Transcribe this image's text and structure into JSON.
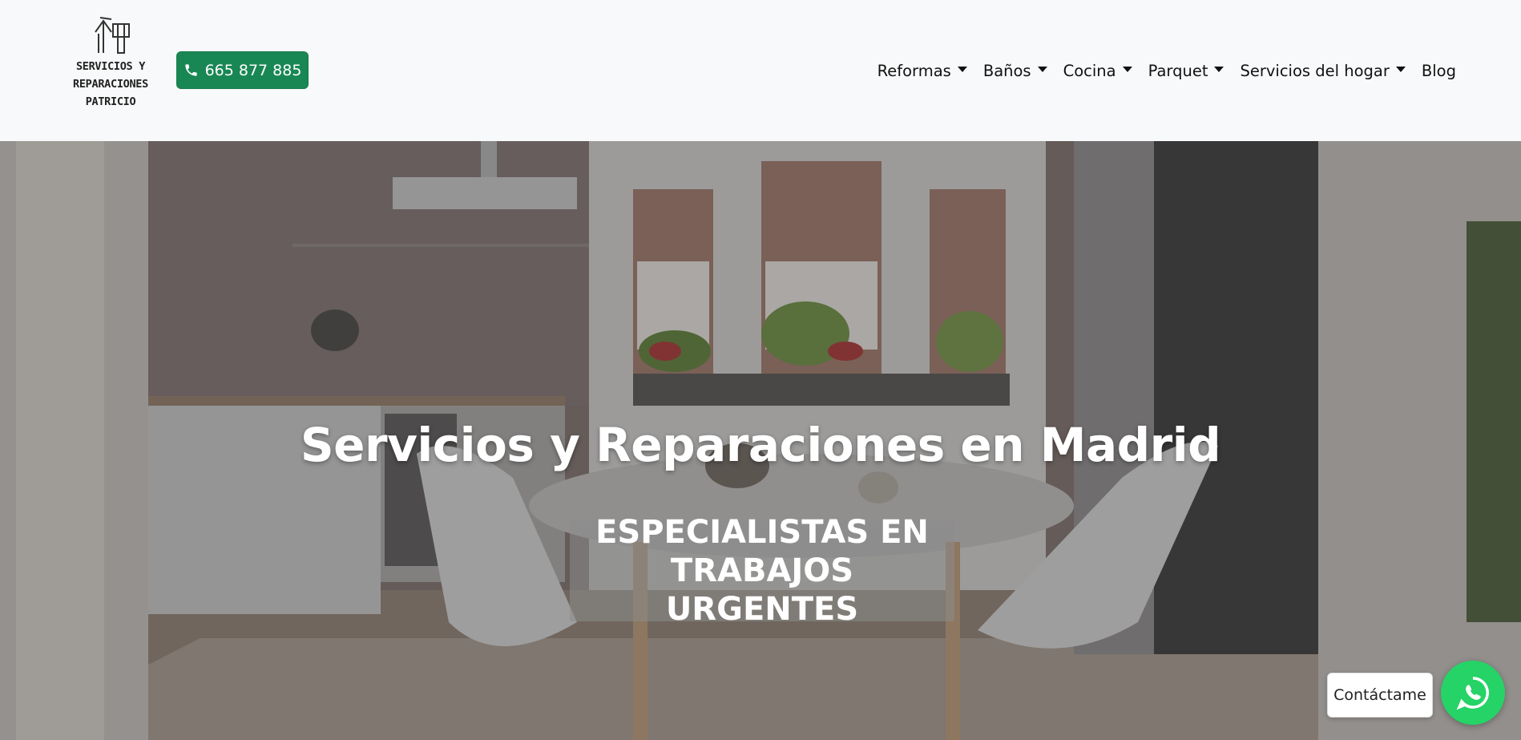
{
  "header": {
    "brand_lines": [
      "SERVICIOS Y",
      "REPARACIONES",
      "PATRICIO"
    ],
    "logo_icon": "tools-icon",
    "phone_label": "665 877 885",
    "phone_icon": "phone-icon",
    "accent": "#198754"
  },
  "nav": {
    "items": [
      {
        "label": "Reformas",
        "dropdown": true
      },
      {
        "label": "Baños",
        "dropdown": true
      },
      {
        "label": "Cocina",
        "dropdown": true
      },
      {
        "label": "Parquet",
        "dropdown": true
      },
      {
        "label": "Servicios del hogar",
        "dropdown": true
      },
      {
        "label": "Blog",
        "dropdown": false
      }
    ]
  },
  "hero": {
    "title": "Servicios y Reparaciones en Madrid",
    "badge": "ESPECIALISTAS EN TRABAJOS URGENTES"
  },
  "floating": {
    "contact_label": "Contáctame",
    "whatsapp_icon": "whatsapp-icon",
    "whatsapp_color": "#25d366"
  }
}
